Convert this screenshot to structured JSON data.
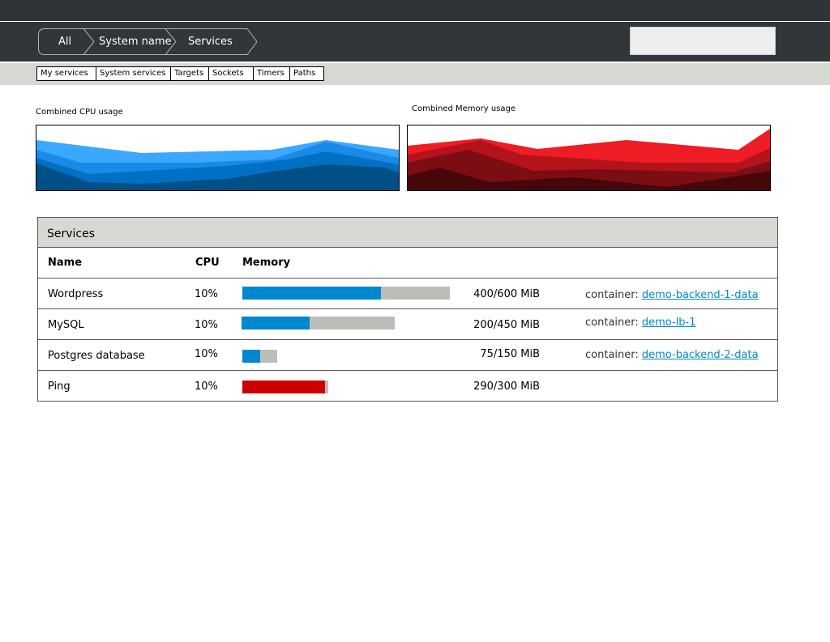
{
  "breadcrumb": {
    "items": [
      "All",
      "System name",
      "Services"
    ]
  },
  "search": {
    "value": ""
  },
  "tabs": [
    "My services",
    "System services",
    "Targets",
    "Sockets",
    "Timers",
    "Paths"
  ],
  "charts": {
    "cpu_title": "Combined CPU usage",
    "memory_title": "Combined Memory usage",
    "cpu_colors": [
      "#3aa8ff",
      "#1a8ae6",
      "#0070c4",
      "#004f86"
    ],
    "memory_colors": [
      "#ee1c25",
      "#b3131b",
      "#7c0d12",
      "#450709"
    ]
  },
  "services": {
    "title": "Services",
    "columns": {
      "name": "Name",
      "cpu": "CPU",
      "memory": "Memory"
    },
    "container_prefix": "container:",
    "rows": [
      {
        "name": "Wordpress",
        "cpu": "10%",
        "memory": "400/600 MiB",
        "used_mib": 400,
        "total_mib": 600,
        "color": "#0088ce",
        "container": "demo-backend-1-data"
      },
      {
        "name": "MySQL",
        "cpu": "10%",
        "memory": "200/450 MiB",
        "used_mib": 200,
        "total_mib": 450,
        "color": "#0088ce",
        "container": "demo-lb-1"
      },
      {
        "name": "Postgres database",
        "cpu": "10%",
        "memory": "75/150 MiB",
        "used_mib": 75,
        "total_mib": 150,
        "color": "#0088ce",
        "container": "demo-backend-2-data"
      },
      {
        "name": "Ping",
        "cpu": "10%",
        "memory": "290/300 MiB",
        "used_mib": 290,
        "total_mib": 300,
        "color": "#cc0000",
        "container": ""
      }
    ]
  }
}
